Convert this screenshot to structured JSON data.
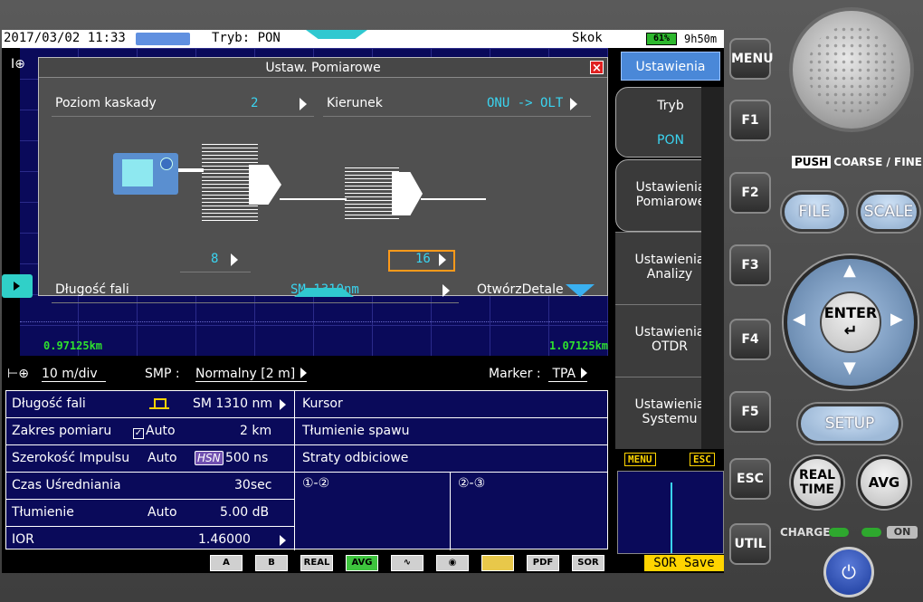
{
  "status": {
    "datetime": "2017/03/02 11:33",
    "mode": "Tryb: PON",
    "skok": "Skok",
    "battery": "61%",
    "time_left": "9h50m"
  },
  "trace": {
    "dist_left": "0.97125km",
    "dist_right": "1.07125km"
  },
  "dialog": {
    "title": "Ustaw. Pomiarowe",
    "cascade_label": "Poziom kaskady",
    "cascade_value": "2",
    "direction_label": "Kierunek",
    "direction_value": "ONU -> OLT",
    "split1_value": "8",
    "split2_value": "16",
    "wavelength_label": "Długość fali",
    "wavelength_value": "SM 1310nm",
    "open_details": "OtwórzDetale"
  },
  "midbar": {
    "scale": "10 m/div",
    "smp_label": "SMP :",
    "smp_value": "Normalny [2 m]",
    "marker_label": "Marker :",
    "marker_value": "TPA"
  },
  "params": [
    {
      "label": "Długość fali",
      "mode": "",
      "value": "SM 1310 nm"
    },
    {
      "label": "Zakres pomiaru",
      "mode": "Auto",
      "value": "2 km"
    },
    {
      "label": "Szerokość Impulsu",
      "mode": "Auto",
      "badge": "HSN",
      "value": "500 ns"
    },
    {
      "label": "Czas Uśredniania",
      "mode": "",
      "value": "30sec"
    },
    {
      "label": "Tłumienie",
      "mode": "Auto",
      "value": "5.00 dB"
    },
    {
      "label": "IOR",
      "mode": "",
      "value": "1.46000"
    }
  ],
  "right_panel": {
    "cursor": "Kursor",
    "splice_loss": "Tłumienie spawu",
    "return_loss": "Straty odbiciowe",
    "col1": "①-②",
    "col2": "②-③"
  },
  "toolbar": [
    "A",
    "B",
    "REAL",
    "AVG",
    "",
    "",
    "",
    "PDF",
    "SOR"
  ],
  "fmenu": {
    "title": "Ustawienia",
    "f1_line1": "Tryb",
    "f1_line2": "PON",
    "f2_line1": "Ustawienia",
    "f2_line2": "Pomiarowe",
    "f3_line1": "Ustawienia",
    "f3_line2": "Analizy",
    "f4_line1": "Ustawienia",
    "f4_line2": "OTDR",
    "f5_line1": "Ustawienia",
    "f5_line2": "Systemu",
    "menu_tag": "MENU",
    "esc_tag": "ESC",
    "sor_save": "SOR Save"
  },
  "hardkeys": {
    "menu": "MENU",
    "f1": "F1",
    "f2": "F2",
    "f3": "F3",
    "f4": "F4",
    "f5": "F5",
    "esc": "ESC",
    "util": "UTIL",
    "push": "PUSH",
    "coarse_fine": "COARSE / FINE",
    "file": "FILE",
    "scale": "SCALE",
    "enter": "ENTER",
    "setup": "SETUP",
    "realtime_1": "REAL",
    "realtime_2": "TIME",
    "avg": "AVG",
    "charge": "CHARGE",
    "on": "ON"
  },
  "colors": {
    "accent_cyan": "#3ad4f0",
    "selection_orange": "#ff9a1a",
    "trace_bg": "#0a0a5a",
    "distance_green": "#2ee02e"
  }
}
